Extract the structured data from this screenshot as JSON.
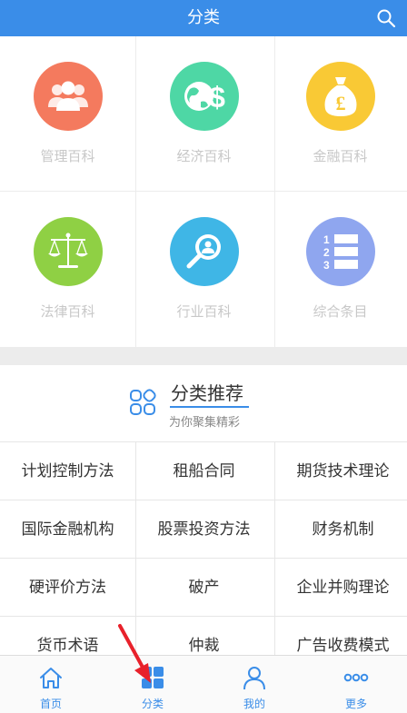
{
  "header": {
    "title": "分类"
  },
  "categories": [
    {
      "label": "管理百科",
      "icon": "people-icon",
      "color": "#f47a5e"
    },
    {
      "label": "经济百科",
      "icon": "globe-dollar-icon",
      "color": "#4ed7a5"
    },
    {
      "label": "金融百科",
      "icon": "money-bag-icon",
      "color": "#f9c935"
    },
    {
      "label": "法律百科",
      "icon": "scales-icon",
      "color": "#8fd044"
    },
    {
      "label": "行业百科",
      "icon": "magnifier-person-icon",
      "color": "#3fb6e6"
    },
    {
      "label": "综合条目",
      "icon": "numbered-list-icon",
      "color": "#8fa6ef"
    }
  ],
  "recommend": {
    "title": "分类推荐",
    "subtitle": "为你聚集精彩",
    "items": [
      "计划控制方法",
      "租船合同",
      "期货技术理论",
      "国际金融机构",
      "股票投资方法",
      "财务机制",
      "硬评价方法",
      "破产",
      "企业并购理论",
      "货币术语",
      "仲裁",
      "广告收费模式"
    ]
  },
  "tabbar": {
    "items": [
      {
        "label": "首页",
        "icon": "home-icon"
      },
      {
        "label": "分类",
        "icon": "category-icon"
      },
      {
        "label": "我的",
        "icon": "user-icon"
      },
      {
        "label": "更多",
        "icon": "more-dots-icon"
      }
    ],
    "active_color": "#3a8de8"
  },
  "colors": {
    "primary": "#3a8de8",
    "separator": "#ececec",
    "arrow": "#e8212b"
  }
}
